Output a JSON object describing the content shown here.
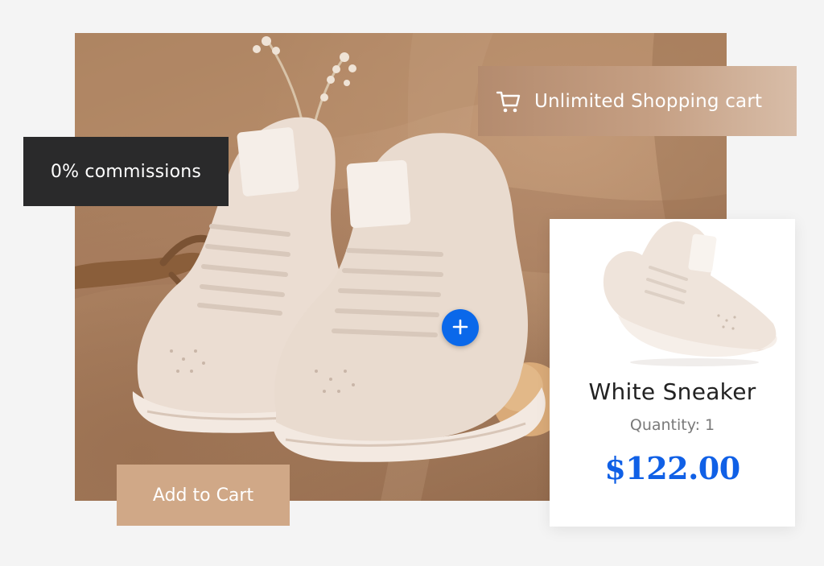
{
  "badges": {
    "cart_label": "Unlimited Shopping cart",
    "cart_icon": "shopping-cart-icon",
    "commission_label": "0% commissions"
  },
  "actions": {
    "add_to_cart_label": "Add to Cart",
    "plus_icon": "plus-icon"
  },
  "product": {
    "name": "White Sneaker",
    "quantity": "Quantity: 1",
    "price": "$122.00"
  },
  "colors": {
    "accent_blue": "#0a68ea",
    "price_blue": "#1060e6",
    "dark_badge": "#2a2a2b",
    "tan_button": "#d0a887"
  }
}
